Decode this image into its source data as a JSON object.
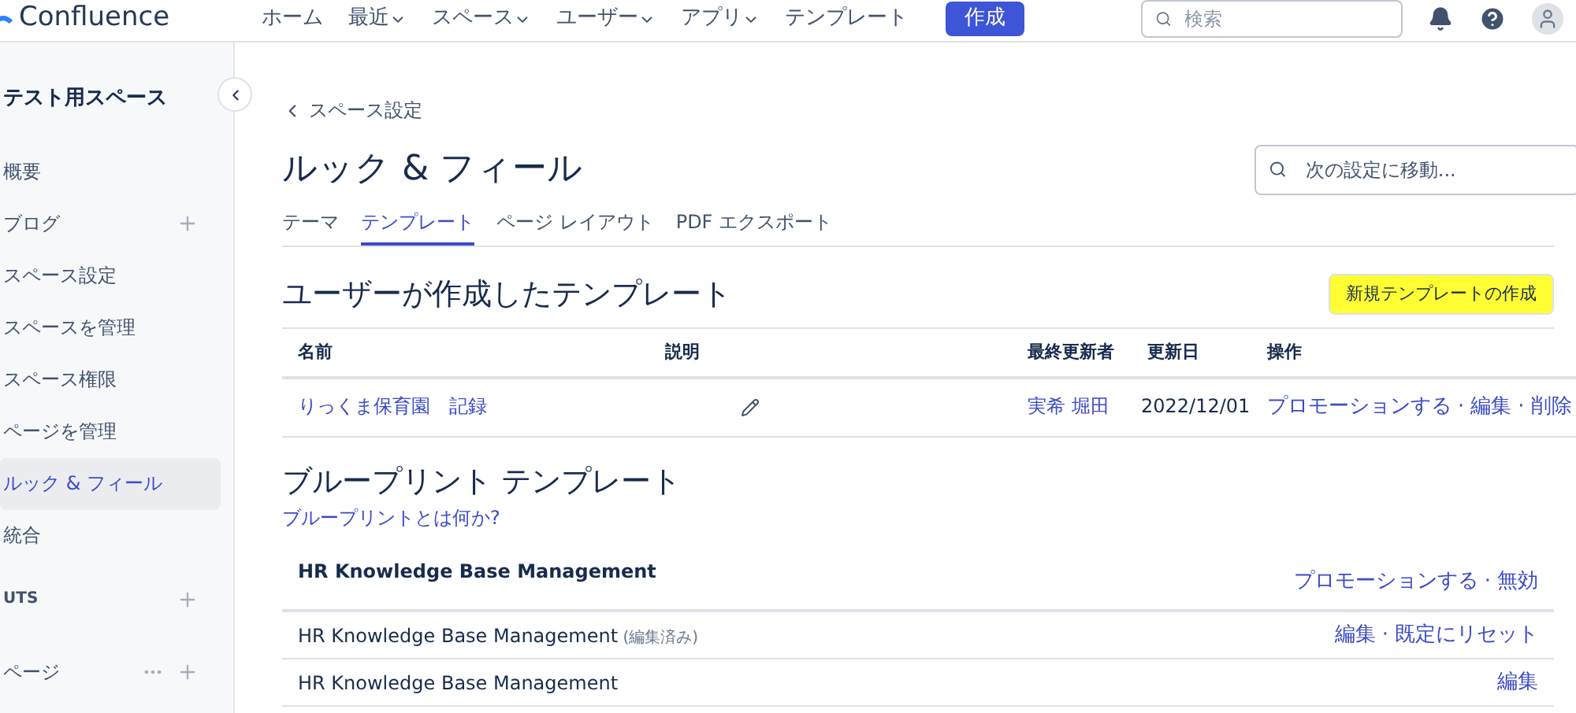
{
  "topbar": {
    "logo": "Confluence",
    "nav": [
      {
        "label": "ホーム",
        "dropdown": false
      },
      {
        "label": "最近",
        "dropdown": true
      },
      {
        "label": "スペース",
        "dropdown": true
      },
      {
        "label": "ユーザー",
        "dropdown": true
      },
      {
        "label": "アプリ",
        "dropdown": true
      },
      {
        "label": "テンプレート",
        "dropdown": false
      }
    ],
    "create": "作成",
    "search": {
      "placeholder": "検索"
    }
  },
  "sidebar": {
    "space_title": "テスト用スペース",
    "items": [
      {
        "label": "概要",
        "selected": false,
        "add": false
      },
      {
        "label": "ブログ",
        "selected": false,
        "add": true
      },
      {
        "label": "スペース設定",
        "selected": false,
        "add": false
      },
      {
        "label": "スペースを管理",
        "selected": false,
        "add": false
      },
      {
        "label": "スペース権限",
        "selected": false,
        "add": false
      },
      {
        "label": "ページを管理",
        "selected": false,
        "add": false
      },
      {
        "label": "ルック & フィール",
        "selected": true,
        "add": false
      },
      {
        "label": "統合",
        "selected": false,
        "add": false
      }
    ],
    "shortcuts": "UTS",
    "pages": "ページ"
  },
  "main": {
    "back": "スペース設定",
    "title": "ルック & フィール",
    "settings_search": {
      "placeholder": "次の設定に移動..."
    },
    "tabs": [
      {
        "label": "テーマ",
        "selected": false
      },
      {
        "label": "テンプレート",
        "selected": true
      },
      {
        "label": "ページ レイアウト",
        "selected": false
      },
      {
        "label": "PDF エクスポート",
        "selected": false
      }
    ],
    "user_templates": {
      "heading": "ユーザーが作成したテンプレート",
      "create_button": {
        "label": "新規テンプレートの作成",
        "highlighted": true
      },
      "columns": [
        "名前",
        "説明",
        "最終更新者",
        "更新日",
        "操作"
      ],
      "rows": [
        {
          "name": "りっくま保育園　記録",
          "author": "実希 堀田",
          "date": "2022/12/01",
          "actions": [
            "プロモーションする",
            "編集",
            "削除"
          ]
        }
      ]
    },
    "blueprints": {
      "heading": "ブループリント テンプレート",
      "help_link": "ブループリントとは何か?",
      "rows": [
        {
          "name": "HR Knowledge Base Management",
          "kind": "group",
          "note": "",
          "actions": [
            "プロモーションする",
            "無効"
          ]
        },
        {
          "name": "HR Knowledge Base Management",
          "kind": "item",
          "note": "(編集済み)",
          "actions": [
            "編集",
            "既定にリセット"
          ]
        },
        {
          "name": "HR Knowledge Base Management",
          "kind": "item",
          "note": "",
          "actions": [
            "編集"
          ]
        }
      ]
    },
    "separator": "·"
  }
}
